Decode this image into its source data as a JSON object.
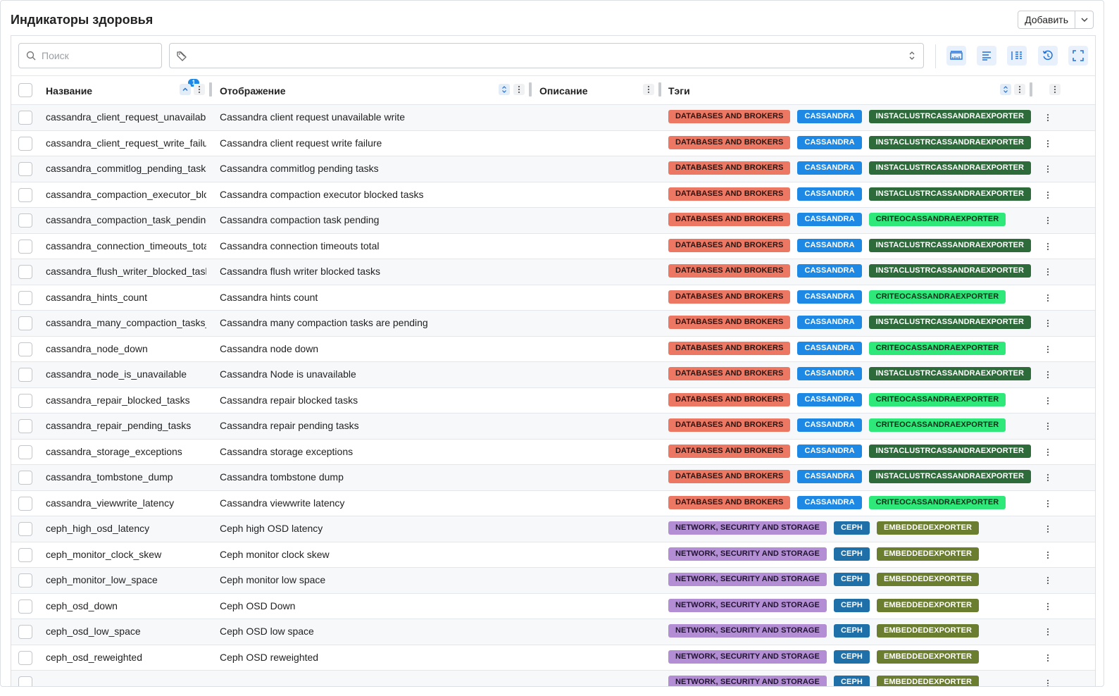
{
  "header": {
    "title": "Индикаторы здоровья",
    "add_label": "Добавить"
  },
  "toolbar": {
    "search_placeholder": "Поиск"
  },
  "columns": {
    "name": "Название",
    "display": "Отображение",
    "description": "Описание",
    "tags": "Тэги",
    "sort_badge": "1"
  },
  "tag_colors": {
    "DATABASES AND BROKERS": {
      "bg": "#ec7864",
      "fg": "#2b1410"
    },
    "CASSANDRA": {
      "bg": "#1e88e5",
      "fg": "#ffffff"
    },
    "INSTACLUSTRCASSANDRAEXPORTER": {
      "bg": "#2e6b3a",
      "fg": "#ffffff"
    },
    "CRITEOCASSANDRAEXPORTER": {
      "bg": "#2ee87a",
      "fg": "#0f2e1a"
    },
    "NETWORK, SECURITY AND STORAGE": {
      "bg": "#b48ed4",
      "fg": "#1f1430"
    },
    "CEPH": {
      "bg": "#1f6fa8",
      "fg": "#ffffff"
    },
    "EMBEDDEDEXPORTER": {
      "bg": "#6b7d2e",
      "fg": "#ffffff"
    }
  },
  "rows": [
    {
      "name": "cassandra_client_request_unavailable_",
      "display": "Cassandra client request unavailable write",
      "description": "",
      "tags": [
        "DATABASES AND BROKERS",
        "CASSANDRA",
        "INSTACLUSTRCASSANDRAEXPORTER"
      ]
    },
    {
      "name": "cassandra_client_request_write_failure",
      "display": "Cassandra client request write failure",
      "description": "",
      "tags": [
        "DATABASES AND BROKERS",
        "CASSANDRA",
        "INSTACLUSTRCASSANDRAEXPORTER"
      ]
    },
    {
      "name": "cassandra_commitlog_pending_tasks",
      "display": "Cassandra commitlog pending tasks",
      "description": "",
      "tags": [
        "DATABASES AND BROKERS",
        "CASSANDRA",
        "INSTACLUSTRCASSANDRAEXPORTER"
      ]
    },
    {
      "name": "cassandra_compaction_executor_bloc",
      "display": "Cassandra compaction executor blocked tasks",
      "description": "",
      "tags": [
        "DATABASES AND BROKERS",
        "CASSANDRA",
        "INSTACLUSTRCASSANDRAEXPORTER"
      ]
    },
    {
      "name": "cassandra_compaction_task_pending",
      "display": "Cassandra compaction task pending",
      "description": "",
      "tags": [
        "DATABASES AND BROKERS",
        "CASSANDRA",
        "CRITEOCASSANDRAEXPORTER"
      ]
    },
    {
      "name": "cassandra_connection_timeouts_total",
      "display": "Cassandra connection timeouts total",
      "description": "",
      "tags": [
        "DATABASES AND BROKERS",
        "CASSANDRA",
        "INSTACLUSTRCASSANDRAEXPORTER"
      ]
    },
    {
      "name": "cassandra_flush_writer_blocked_tasks",
      "display": "Cassandra flush writer blocked tasks",
      "description": "",
      "tags": [
        "DATABASES AND BROKERS",
        "CASSANDRA",
        "INSTACLUSTRCASSANDRAEXPORTER"
      ]
    },
    {
      "name": "cassandra_hints_count",
      "display": "Cassandra hints count",
      "description": "",
      "tags": [
        "DATABASES AND BROKERS",
        "CASSANDRA",
        "CRITEOCASSANDRAEXPORTER"
      ]
    },
    {
      "name": "cassandra_many_compaction_tasks_a",
      "display": "Cassandra many compaction tasks are pending",
      "description": "",
      "tags": [
        "DATABASES AND BROKERS",
        "CASSANDRA",
        "INSTACLUSTRCASSANDRAEXPORTER"
      ]
    },
    {
      "name": "cassandra_node_down",
      "display": "Cassandra node down",
      "description": "",
      "tags": [
        "DATABASES AND BROKERS",
        "CASSANDRA",
        "CRITEOCASSANDRAEXPORTER"
      ]
    },
    {
      "name": "cassandra_node_is_unavailable",
      "display": "Cassandra Node is unavailable",
      "description": "",
      "tags": [
        "DATABASES AND BROKERS",
        "CASSANDRA",
        "INSTACLUSTRCASSANDRAEXPORTER"
      ]
    },
    {
      "name": "cassandra_repair_blocked_tasks",
      "display": "Cassandra repair blocked tasks",
      "description": "",
      "tags": [
        "DATABASES AND BROKERS",
        "CASSANDRA",
        "CRITEOCASSANDRAEXPORTER"
      ]
    },
    {
      "name": "cassandra_repair_pending_tasks",
      "display": "Cassandra repair pending tasks",
      "description": "",
      "tags": [
        "DATABASES AND BROKERS",
        "CASSANDRA",
        "CRITEOCASSANDRAEXPORTER"
      ]
    },
    {
      "name": "cassandra_storage_exceptions",
      "display": "Cassandra storage exceptions",
      "description": "",
      "tags": [
        "DATABASES AND BROKERS",
        "CASSANDRA",
        "INSTACLUSTRCASSANDRAEXPORTER"
      ]
    },
    {
      "name": "cassandra_tombstone_dump",
      "display": "Cassandra tombstone dump",
      "description": "",
      "tags": [
        "DATABASES AND BROKERS",
        "CASSANDRA",
        "INSTACLUSTRCASSANDRAEXPORTER"
      ]
    },
    {
      "name": "cassandra_viewwrite_latency",
      "display": "Cassandra viewwrite latency",
      "description": "",
      "tags": [
        "DATABASES AND BROKERS",
        "CASSANDRA",
        "CRITEOCASSANDRAEXPORTER"
      ]
    },
    {
      "name": "ceph_high_osd_latency",
      "display": "Ceph high OSD latency",
      "description": "",
      "tags": [
        "NETWORK, SECURITY AND STORAGE",
        "CEPH",
        "EMBEDDEDEXPORTER"
      ]
    },
    {
      "name": "ceph_monitor_clock_skew",
      "display": "Ceph monitor clock skew",
      "description": "",
      "tags": [
        "NETWORK, SECURITY AND STORAGE",
        "CEPH",
        "EMBEDDEDEXPORTER"
      ]
    },
    {
      "name": "ceph_monitor_low_space",
      "display": "Ceph monitor low space",
      "description": "",
      "tags": [
        "NETWORK, SECURITY AND STORAGE",
        "CEPH",
        "EMBEDDEDEXPORTER"
      ]
    },
    {
      "name": "ceph_osd_down",
      "display": "Ceph OSD Down",
      "description": "",
      "tags": [
        "NETWORK, SECURITY AND STORAGE",
        "CEPH",
        "EMBEDDEDEXPORTER"
      ]
    },
    {
      "name": "ceph_osd_low_space",
      "display": "Ceph OSD low space",
      "description": "",
      "tags": [
        "NETWORK, SECURITY AND STORAGE",
        "CEPH",
        "EMBEDDEDEXPORTER"
      ]
    },
    {
      "name": "ceph_osd_reweighted",
      "display": "Ceph OSD reweighted",
      "description": "",
      "tags": [
        "NETWORK, SECURITY AND STORAGE",
        "CEPH",
        "EMBEDDEDEXPORTER"
      ]
    },
    {
      "name": "",
      "display": "",
      "description": "",
      "tags": [
        "NETWORK, SECURITY AND STORAGE",
        "CEPH",
        "EMBEDDEDEXPORTER"
      ]
    }
  ]
}
